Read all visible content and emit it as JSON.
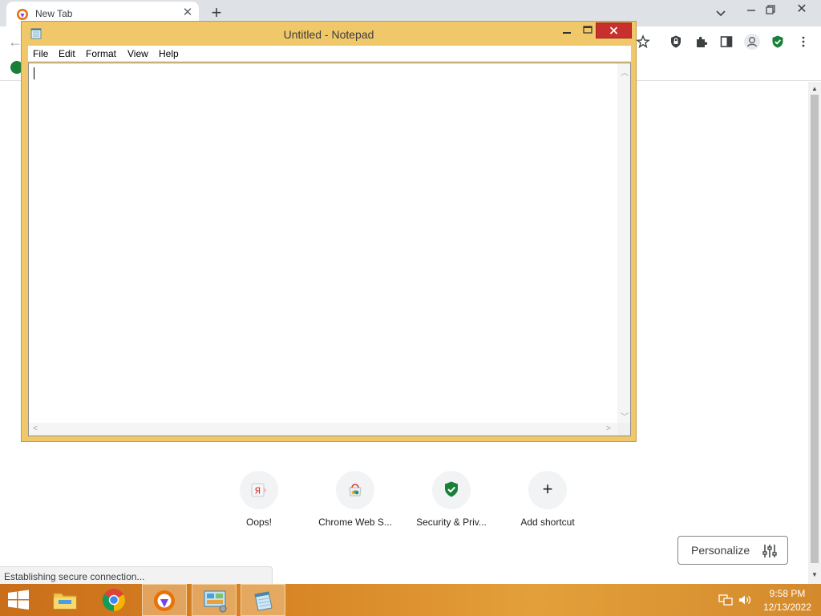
{
  "browser": {
    "tab": {
      "title": "New Tab",
      "close_glyph": "✕"
    },
    "new_tab_glyph": "+",
    "window_close_glyph": "✕",
    "back_glyph": "←",
    "shortcuts": [
      {
        "label": "Oops!",
        "icon": "yandex-icon"
      },
      {
        "label": "Chrome Web S...",
        "icon": "chrome-web-store-icon"
      },
      {
        "label": "Security & Priv...",
        "icon": "shield-check-icon"
      },
      {
        "label": "Add shortcut",
        "icon": "plus-icon",
        "glyph": "+"
      }
    ],
    "personalize": {
      "label": "Personalize",
      "icon": "sliders-icon"
    },
    "status_text": "Establishing secure connection..."
  },
  "notepad": {
    "title": "Untitled - Notepad",
    "menu": [
      "File",
      "Edit",
      "Format",
      "View",
      "Help"
    ],
    "content": ""
  },
  "taskbar": {
    "apps": [
      "file-explorer-icon",
      "chrome-icon",
      "browser-icon",
      "control-panel-icon",
      "notepad-icon"
    ],
    "time": "9:58 PM",
    "date": "12/13/2022"
  },
  "colors": {
    "notepad_frame": "#f0c869",
    "close_button": "#c7302c",
    "taskbar": "#d88525",
    "shield_green": "#188038"
  }
}
